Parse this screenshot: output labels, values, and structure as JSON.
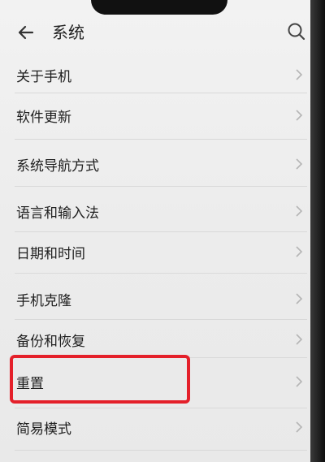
{
  "header": {
    "title": "系统"
  },
  "menu": {
    "items": [
      {
        "label": "关于手机"
      },
      {
        "label": "软件更新"
      },
      {
        "label": "系统导航方式"
      },
      {
        "label": "语言和输入法"
      },
      {
        "label": "日期和时间"
      },
      {
        "label": "手机克隆"
      },
      {
        "label": "备份和恢复"
      },
      {
        "label": "重置"
      },
      {
        "label": "简易模式"
      }
    ]
  },
  "colors": {
    "highlight": "#e4202a",
    "text": "#1f1f1f",
    "chevron": "#b5b5b5"
  },
  "icons": {
    "back": "arrow-left-icon",
    "search": "search-icon",
    "chevron": "chevron-right-icon"
  }
}
